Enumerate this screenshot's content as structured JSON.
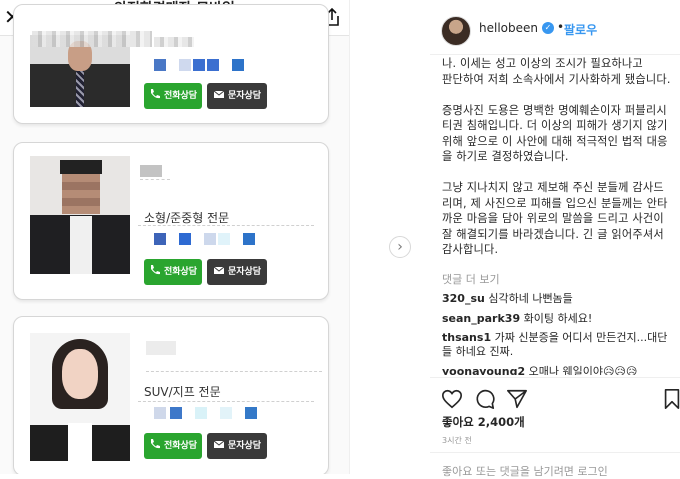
{
  "left": {
    "title": "안전한경매장 모바일",
    "cards": [
      {
        "specialty": "",
        "call": "전화상담",
        "msg": "문자상담"
      },
      {
        "specialty": "소형/준중형 전문",
        "call": "전화상담",
        "msg": "문자상담"
      },
      {
        "specialty": "SUV/지프 전문",
        "call": "전화상담",
        "msg": "문자상담"
      }
    ]
  },
  "right": {
    "username": "hellobeen",
    "follow": "팔로우",
    "dot": "•",
    "caption": "나. 이세는 성고 이상의 조시가 필요하나고\n판단하여 저희 소속사에서 기사화하게 됐습니다.\n\n증명사진 도용은 명백한 명예훼손이자 퍼블리시티권 침해입니다. 더 이상의 피해가 생기지 않기 위해 앞으로 이 사안에 대해 적극적인 법적 대응을 하기로 결정하였습니다.\n\n그냥 지나치지 않고 제보해 주신 분들께 감사드리며, 제 사진으로 피해를 입으신 분들께는 안타까운 마음을 담아 위로의 말씀을 드리고 사건이 잘 해결되기를 바라겠습니다. 긴 글 읽어주셔서 감사합니다.",
    "more_comments": "댓글 더 보기",
    "comments": [
      {
        "user": "320_su",
        "text": "심각하네 나뻔놈들"
      },
      {
        "user": "sean_park39",
        "text": "화이팅 하세요!"
      },
      {
        "user": "thsans1",
        "text": "가짜 신분증을 어디서 만든건지...대단들 하네요 진짜."
      },
      {
        "user": "yoonayoung2",
        "text": "오매나 웨일이야😥😥😥"
      }
    ],
    "likes": "좋아요 2,400개",
    "time": "3시간 전",
    "bottom_partial": "좋아요 또는 댓글을 남기려면 로그인"
  }
}
